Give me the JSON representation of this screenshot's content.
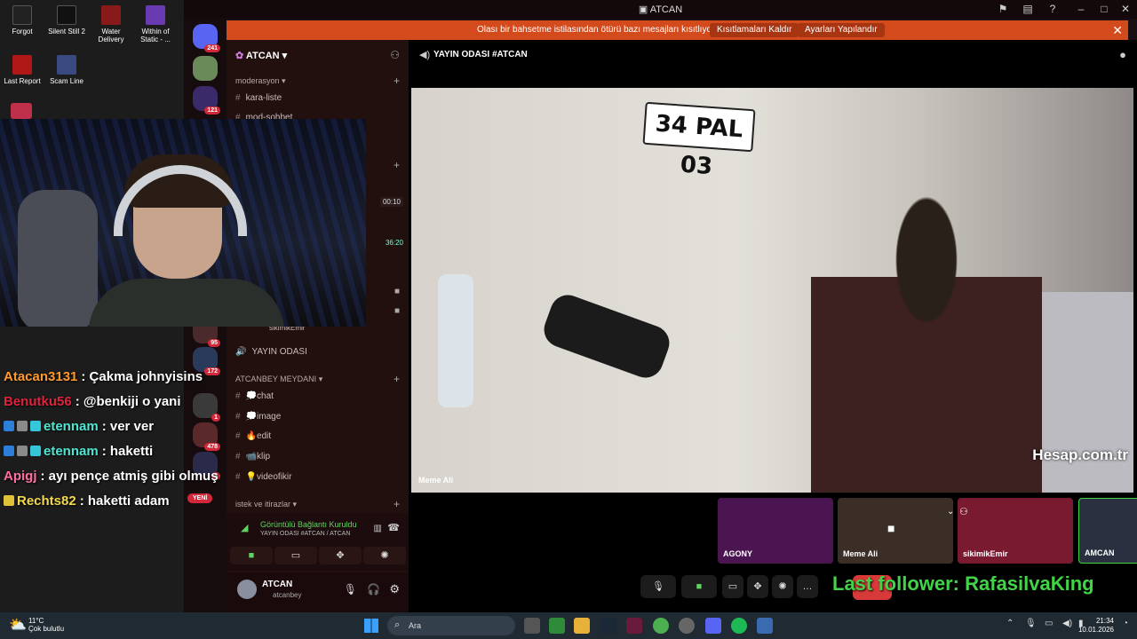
{
  "desktop": {
    "icons": [
      {
        "label": "Forgot",
        "color": "#222222"
      },
      {
        "label": "Silent Still 2",
        "color": "#1a1a1a"
      },
      {
        "label": "Water Delivery",
        "color": "#8a1a1a"
      },
      {
        "label": "Within of Static - ...",
        "color": "#6a3ab0"
      },
      {
        "label": "Last Report",
        "color": "#b01818"
      },
      {
        "label": "Scam Line",
        "color": "#3a4a80"
      }
    ]
  },
  "chat": {
    "lines": [
      {
        "user": "Atacan3131",
        "text": ": Çakma johnyisins",
        "color": "#ff9a2e"
      },
      {
        "user": "Benutku56",
        "text": ": @benkiji o yani",
        "color": "#e0233d"
      },
      {
        "user": "etennam",
        "text": ": ver ver",
        "color": "#4ee6d2"
      },
      {
        "user": "etennam",
        "text": ": haketti",
        "color": "#4ee6d2"
      },
      {
        "user": "Apigj",
        "text": ": ayı pençe atmiş gibi olmuş",
        "color": "#ff6fa3"
      },
      {
        "user": "Rechts82",
        "text": ": haketti adam",
        "color": "#f2d94e"
      }
    ]
  },
  "discord": {
    "window_title": "ATCAN",
    "notice": {
      "message": "Olası bir bahsetme istilasından ötürü bazı mesajları kısıtlıyoruz",
      "btn_remove": "Kısıtlamaları Kaldır",
      "btn_settings": "Ayarları Yapılandır"
    },
    "servers": [
      {
        "count": "241",
        "color": "#5865f2"
      },
      {
        "count": "",
        "color": "#6a8a5a"
      },
      {
        "count": "121",
        "color": "#3a2a6a"
      },
      {
        "count": "95",
        "color": "#4a2a2a"
      },
      {
        "count": "172",
        "color": "#2a3a5a"
      },
      {
        "count": "1",
        "color": "#3a3a3a"
      },
      {
        "count": "478",
        "color": "#5a2a2a"
      },
      {
        "count": "4",
        "color": "#2a2a4a"
      }
    ],
    "new_badge": "YENİ",
    "server_name": "ATCAN",
    "categories": {
      "moderasyon": "moderasyon",
      "meydan": "ATCANBEY MEYDANI",
      "istek": "istek ve itirazlar"
    },
    "channels_top": [
      "kara-liste",
      "mod-sohbet"
    ],
    "voice_user": "sikimikEmir",
    "voice_channel": "YAYIN ODASI",
    "meydan_channels": [
      "💭chat",
      "💭image",
      "🔥edit",
      "📹klip",
      "💡videofikir"
    ],
    "side_times": [
      "00:10",
      "36:20"
    ],
    "voice_panel": {
      "status": "Görüntülü Bağlantı Kuruldu",
      "sub": "YAYIN ODASI #ATCAN / ATCAN"
    },
    "user": {
      "name": "ATCAN",
      "tag": "atcanbey"
    },
    "main_title": "YAYIN ODASI #ATCAN",
    "plate": "34 PAL 03",
    "stream_label": "Meme Ali",
    "watermark": "Hesap.com.tr",
    "tiles": [
      {
        "label": "AGONY",
        "color": "#6a1a6a"
      },
      {
        "label": "Meme Ali",
        "color": "#3a2e26"
      },
      {
        "label": "sikimikEmir",
        "color": "#8a1a3a"
      },
      {
        "label": "AMCAN",
        "color": "#2a3040"
      }
    ],
    "last_follower": "Last follower: RafasilvaKing"
  },
  "taskbar": {
    "weather_temp": "11°C",
    "weather_desc": "Çok bulutlu",
    "search_placeholder": "Ara",
    "time": "21:34",
    "date": "10.01.2026"
  }
}
